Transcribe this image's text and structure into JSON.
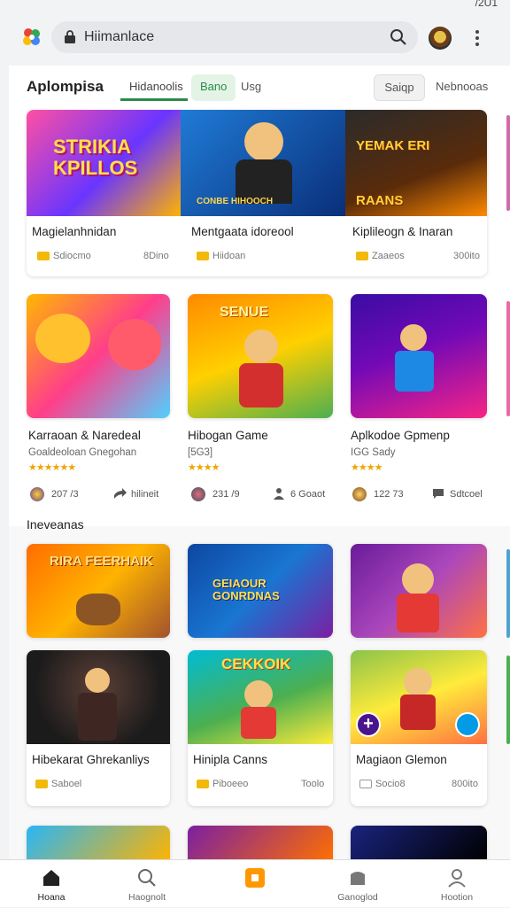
{
  "status": {
    "time": "/2U1"
  },
  "topbar": {
    "search_text": "Hiimanlace"
  },
  "header": {
    "app_title": "Aplompisa",
    "tabs": [
      {
        "label": "Hidanoolis"
      },
      {
        "label": "Bano"
      },
      {
        "label": "Usg"
      },
      {
        "label": "Saiqp"
      },
      {
        "label": "Nebnooas"
      }
    ]
  },
  "featured": [
    {
      "title": "Magielanhnidan",
      "meta_left": "Sdiocmo",
      "meta_right": "8Dino",
      "art": "STRIKIA KPILLOS"
    },
    {
      "title": "Mentgaata idoreool",
      "meta_left": "Hiidoan",
      "meta_right": "",
      "art": "CONBE HIHOOCH"
    },
    {
      "title": "Kiplileogn & Inaran",
      "meta_left": "Zaaeos",
      "meta_right": "300ito",
      "art": "YEMAK ERI RAANS"
    }
  ],
  "popular": [
    {
      "title": "Karraoan & Naredeal",
      "subtitle": "Goaldeoloan Gnegohan",
      "stars": "★★★★★★",
      "stat1": "207 /3",
      "stat2": "hilineit"
    },
    {
      "title": "Hibogan Game",
      "subtitle": "[5G3]",
      "stars": "★★★★",
      "stat1": "231 /9",
      "stat2": "6 Goaot"
    },
    {
      "title": "Aplkodoe Gpmenp",
      "subtitle": "IGG Sady",
      "stars": "★★★★",
      "stat1": "122 73",
      "stat2": "Sdtcoel"
    }
  ],
  "section": {
    "title": "Ineveanas"
  },
  "grid": [
    {
      "art": "RIRA FEERHAIK"
    },
    {
      "art": "GEIAOUR GONRDNAS"
    },
    {
      "art": ""
    },
    {
      "art": ""
    },
    {
      "art": "CEKKOIK"
    },
    {
      "art": ""
    }
  ],
  "grid_cards": [
    {
      "title": "Hibekarat Ghrekanliys",
      "meta_left": "Saboel",
      "meta_right": ""
    },
    {
      "title": "Hinipla Canns",
      "meta_left": "Piboeeo",
      "meta_right": "Toolo"
    },
    {
      "title": "Magiaon Glemon",
      "meta_left": "Socio8",
      "meta_right": "800ito"
    }
  ],
  "bottomnav": [
    {
      "label": "Hoana"
    },
    {
      "label": "Haognolt"
    },
    {
      "label": ""
    },
    {
      "label": "Ganoglod"
    },
    {
      "label": "Hootion"
    }
  ]
}
